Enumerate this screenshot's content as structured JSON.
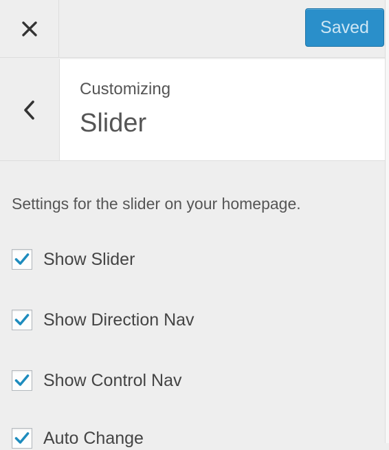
{
  "header": {
    "close_icon": "close-icon",
    "saved_label": "Saved"
  },
  "section": {
    "back_icon": "chevron-left-icon",
    "eyebrow": "Customizing",
    "title": "Slider"
  },
  "controls": {
    "description": "Settings for the slider on your homepage.",
    "options": [
      {
        "label": "Show Slider",
        "checked": true
      },
      {
        "label": "Show Direction Nav",
        "checked": true
      },
      {
        "label": "Show Control Nav",
        "checked": true
      },
      {
        "label": "Auto Change",
        "checked": true
      }
    ]
  },
  "colors": {
    "accent": "#2a8fca",
    "checkmark": "#1e8cbe",
    "background": "#eeeeee"
  }
}
